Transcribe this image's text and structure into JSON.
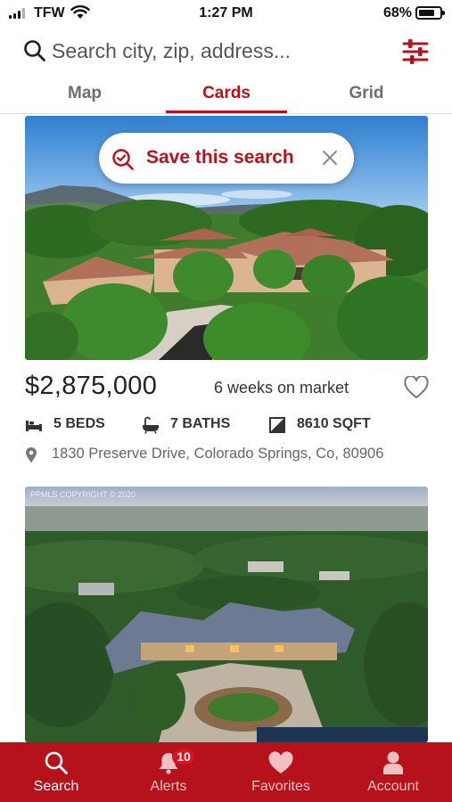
{
  "status_bar": {
    "carrier": "TFW",
    "time": "1:27 PM",
    "battery_percent": "68%",
    "battery_level": 0.68,
    "icons": [
      "signal-icon",
      "wifi-icon",
      "battery-icon"
    ]
  },
  "search": {
    "placeholder": "Search city, zip, address..."
  },
  "tabs": [
    {
      "label": "Map",
      "active": false
    },
    {
      "label": "Cards",
      "active": true
    },
    {
      "label": "Grid",
      "active": false
    }
  ],
  "save_search": {
    "label": "Save this search",
    "icon": "search-check-icon",
    "close_icon": "close-icon"
  },
  "listings": [
    {
      "price": "$2,875,000",
      "days_on_market": "6 weeks on market",
      "favorited": false,
      "beds": "5 BEDS",
      "baths": "7 BATHS",
      "sqft": "8610 SQFT",
      "address": "1830 Preserve Drive, Colorado Springs, Co, 80906"
    },
    {
      "photo_watermark": "PPMLS COPYRIGHT © 2020"
    }
  ],
  "bottom_nav": {
    "items": [
      {
        "label": "Search",
        "icon": "search-icon",
        "active": true
      },
      {
        "label": "Alerts",
        "icon": "bell-icon",
        "active": false,
        "badge": "10"
      },
      {
        "label": "Favorites",
        "icon": "heart-icon",
        "active": false
      },
      {
        "label": "Account",
        "icon": "person-icon",
        "active": false
      }
    ]
  },
  "colors": {
    "brand_red": "#b5121b",
    "text_dark": "#222222",
    "text_muted": "#666666"
  }
}
